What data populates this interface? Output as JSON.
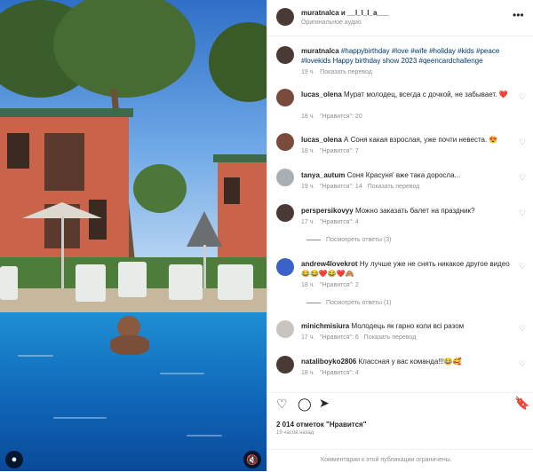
{
  "header": {
    "title": "muratnalca и __l_l_l_a___",
    "subtitle": "Оригинальное аудио",
    "more_icon": "more-horizontal-icon"
  },
  "caption": {
    "username": "muratnalca",
    "text": "#happybirthday #love #wife #holiday #kids #peace #lovekids Happy birthday show 2023 #qeencardchallenge",
    "time": "19 ч.",
    "translate": "Показать перевод"
  },
  "comments": [
    {
      "username": "lucas_olena",
      "text": "Мурат молодец, всегда с дочкой, не забывает. ❤️",
      "time": "18 ч.",
      "likes": "\"Нравится\": 20"
    },
    {
      "username": "lucas_olena",
      "text": "А Соня какая взрослая, уже почти невеста. 😍",
      "time": "18 ч.",
      "likes": "\"Нравится\": 7"
    },
    {
      "username": "tanya_autum",
      "text": "Соня Красуня' вже така доросла...",
      "time": "19 ч.",
      "likes": "\"Нравится\": 14",
      "translate": "Показать перевод"
    },
    {
      "username": "perspersikovyy",
      "text": "Можно заказать балет на праздник?",
      "time": "17 ч.",
      "likes": "\"Нравится\": 4",
      "replies": "Посмотреть ответы (3)"
    },
    {
      "username": "andrew4lovekrot",
      "text": "Ну лучше уже не снять никакое другое видео😂😂❤️😂❤️🙈",
      "time": "18 ч.",
      "likes": "\"Нравится\": 2",
      "replies": "Посмотреть ответы (1)"
    },
    {
      "username": "minichmisiura",
      "text": "Молодець як гарно коли всі разом",
      "time": "17 ч.",
      "likes": "\"Нравится\": 6",
      "translate": "Показать перевод"
    },
    {
      "username": "nataliboyko2806",
      "text": "Классная у вас команда!!!😂🥰",
      "time": "18 ч.",
      "likes": "\"Нравится\": 4"
    }
  ],
  "actions": {
    "likes_count": "2 014 отметок \"Нравится\"",
    "posted": "19 часов назад"
  },
  "footer": {
    "text": "Комментарии к этой публикации ограничены."
  }
}
